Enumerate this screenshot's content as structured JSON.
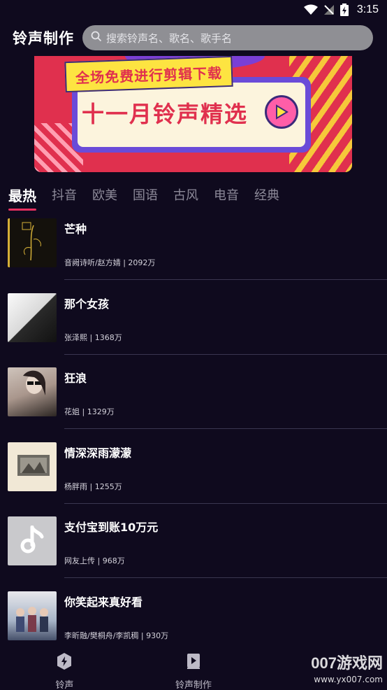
{
  "status_bar": {
    "time": "3:15"
  },
  "header": {
    "title": "铃声制作",
    "search_placeholder": "搜索铃声名、歌名、歌手名"
  },
  "banner": {
    "ribbon_text": "全场免费进行剪辑下载",
    "headline": "十一月铃声精选"
  },
  "tabs": [
    {
      "label": "最热",
      "active": true
    },
    {
      "label": "抖音",
      "active": false
    },
    {
      "label": "欧美",
      "active": false
    },
    {
      "label": "国语",
      "active": false
    },
    {
      "label": "古风",
      "active": false
    },
    {
      "label": "电音",
      "active": false
    },
    {
      "label": "经典",
      "active": false
    }
  ],
  "songs": [
    {
      "title": "芒种",
      "meta": "音阙诗听/赵方婧 | 2092万"
    },
    {
      "title": "那个女孩",
      "meta": "张泽熙 | 1368万"
    },
    {
      "title": "狂浪",
      "meta": "花姐 | 1329万"
    },
    {
      "title": "情深深雨濛濛",
      "meta": "杨胖雨 | 1255万"
    },
    {
      "title": "支付宝到账10万元",
      "meta": "网友上传 | 968万"
    },
    {
      "title": "你笑起来真好看",
      "meta": "李昕融/樊桐舟/李凯稠 | 930万"
    }
  ],
  "bottom_nav": [
    {
      "label": "铃声",
      "icon": "lightning-icon"
    },
    {
      "label": "铃声制作",
      "icon": "video-icon"
    }
  ],
  "watermark": {
    "brand": "007游戏网",
    "url": "www.yx007.com"
  },
  "colors": {
    "background": "#0f0a1e",
    "accent": "#e8305f",
    "search_bg": "#8f8f94"
  }
}
